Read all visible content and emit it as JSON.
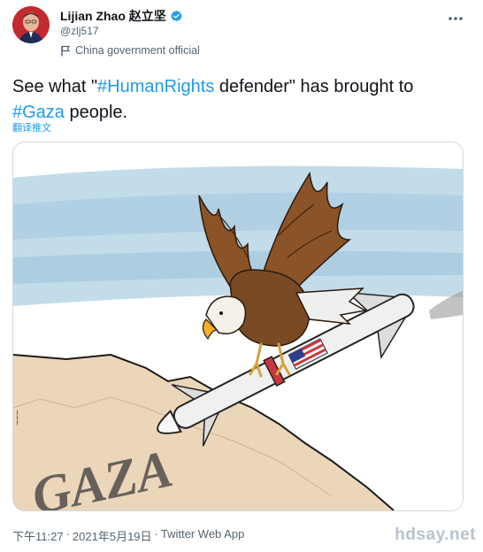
{
  "author": {
    "display_name": "Lijian Zhao 赵立坚",
    "handle": "@zlj517",
    "label": "China government official"
  },
  "tweet": {
    "text_1": "See what \"",
    "hashtag_1": "#HumanRights",
    "text_2": " defender\" has brought to ",
    "hashtag_2": "#Gaza",
    "text_3": " people.",
    "translate_label": "翻译推文"
  },
  "media": {
    "flag_label": "USA flag",
    "ground_text": "GAZA"
  },
  "meta": {
    "time": "下午11:27",
    "separator": "·",
    "date": "2021年5月19日",
    "source": "Twitter Web App"
  },
  "watermark": "hdsay.net",
  "colors": {
    "accent": "#1d9bf0",
    "text": "#0f1419",
    "secondary": "#536471",
    "sky": "#b9d5e6",
    "sand": "#ead4b8",
    "eagle_body": "#7a4a24"
  },
  "icons": {
    "verified": "verified-badge-icon",
    "more": "more-dots-icon",
    "label": "flag-icon"
  }
}
